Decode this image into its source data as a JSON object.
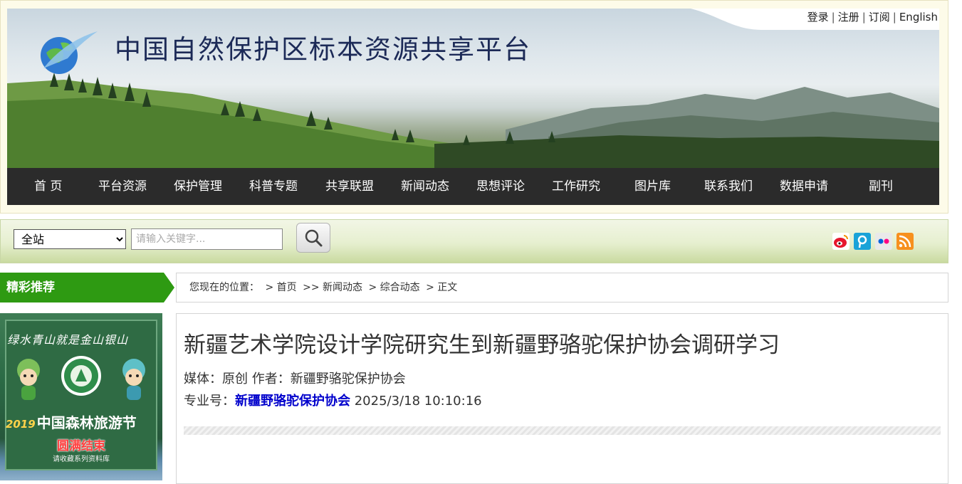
{
  "header": {
    "site_title": "中国自然保护区标本资源共享平台",
    "top_links": [
      "登录",
      "注册",
      "订阅",
      "English"
    ],
    "top_link_separator": "|"
  },
  "nav": {
    "items": [
      "首 页",
      "平台资源",
      "保护管理",
      "科普专题",
      "共享联盟",
      "新闻动态",
      "思想评论",
      "工作研究",
      "图片库",
      "联系我们",
      "数据申请",
      "副刊"
    ]
  },
  "search": {
    "scope_selected": "全站",
    "placeholder": "请输入关键字...",
    "button_icon": "magnifier-icon"
  },
  "social_icons": [
    "weibo-icon",
    "tencent-weibo-icon",
    "flickr-icon",
    "rss-icon"
  ],
  "sidebar": {
    "section_title": "精彩推荐",
    "promo": {
      "slogan": "绿水青山就是金山银山",
      "year": "2019",
      "title": "中国森林旅游节",
      "status": "圆满结束",
      "note": "请收藏系列资料库"
    }
  },
  "breadcrumb": {
    "prefix": "您现在的位置：",
    "items": [
      "> 首页",
      ">> 新闻动态",
      "> 综合动态",
      "> 正文"
    ]
  },
  "article": {
    "title": "新疆艺术学院设计学院研究生到新疆野骆驼保护协会调研学习",
    "meta_line": "媒体：原创  作者：新疆野骆驼保护协会",
    "pro_label": "专业号：",
    "pro_org": "新疆野骆驼保护协会",
    "datetime": "2025/3/18 10:10:16"
  },
  "colors": {
    "nav_bg": "#2b2b2b",
    "recommend_green": "#2e9a12",
    "link_blue": "#0000cc",
    "title_navy": "#1c2a57"
  }
}
